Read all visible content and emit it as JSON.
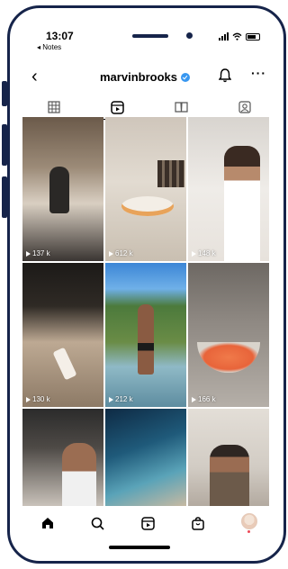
{
  "status_bar": {
    "time": "13:07",
    "back_app": "◂ Notes"
  },
  "header": {
    "back_icon": "chevron-left-icon",
    "username": "marvinbrooks",
    "verified": true,
    "more_label": "···"
  },
  "tabs": [
    {
      "icon": "grid-icon",
      "active": false
    },
    {
      "icon": "reels-icon",
      "active": true
    },
    {
      "icon": "guide-icon",
      "active": false
    },
    {
      "icon": "tagged-icon",
      "active": false
    }
  ],
  "posts": [
    {
      "views": "137 k"
    },
    {
      "views": "612 k"
    },
    {
      "views": "148 k"
    },
    {
      "views": "130 k"
    },
    {
      "views": "212 k"
    },
    {
      "views": "166 k"
    },
    {
      "views": ""
    },
    {
      "views": ""
    },
    {
      "views": ""
    }
  ],
  "nav": [
    {
      "icon": "home-icon"
    },
    {
      "icon": "search-icon"
    },
    {
      "icon": "reels-icon"
    },
    {
      "icon": "shop-icon"
    },
    {
      "icon": "profile-avatar"
    }
  ],
  "colors": {
    "frame": "#16244a",
    "verified": "#3897f0"
  }
}
